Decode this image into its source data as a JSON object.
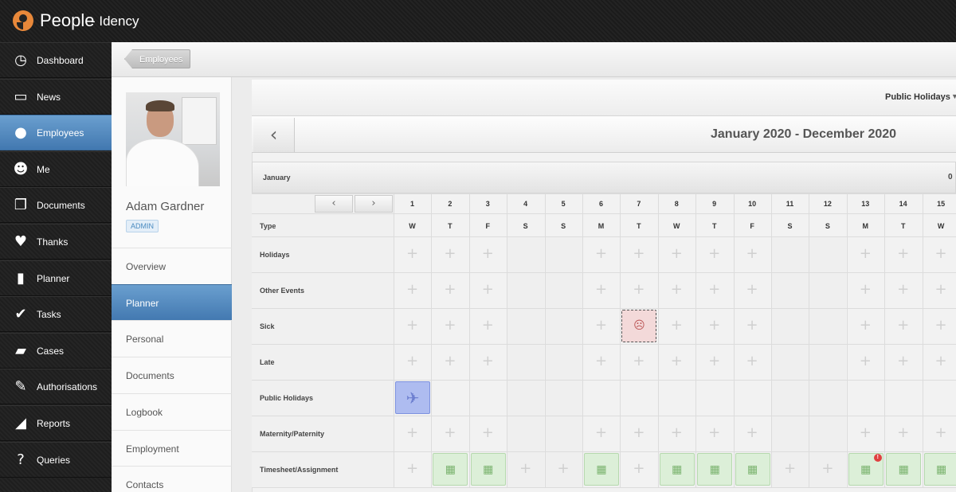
{
  "app": {
    "title": "People",
    "subtitle": "- Idency"
  },
  "sidebar": {
    "items": [
      {
        "label": "Dashboard",
        "icon": "dashboard-icon",
        "glyph": "◷"
      },
      {
        "label": "News",
        "icon": "tv-icon",
        "glyph": "▭"
      },
      {
        "label": "Employees",
        "icon": "people-icon",
        "glyph": "●",
        "active": true
      },
      {
        "label": "Me",
        "icon": "user-star-icon",
        "glyph": "☻"
      },
      {
        "label": "Documents",
        "icon": "documents-icon",
        "glyph": "❐"
      },
      {
        "label": "Thanks",
        "icon": "thumbs-up-icon",
        "glyph": "♥"
      },
      {
        "label": "Planner",
        "icon": "planner-book-icon",
        "glyph": "▮"
      },
      {
        "label": "Tasks",
        "icon": "checkmark-icon",
        "glyph": "✔"
      },
      {
        "label": "Cases",
        "icon": "folder-icon",
        "glyph": "▰"
      },
      {
        "label": "Authorisations",
        "icon": "gavel-icon",
        "glyph": "✎"
      },
      {
        "label": "Reports",
        "icon": "chart-icon",
        "glyph": "◢"
      },
      {
        "label": "Queries",
        "icon": "question-doc-icon",
        "glyph": "?"
      }
    ]
  },
  "breadcrumb": {
    "label": "Employees"
  },
  "profile": {
    "name": "Adam Gardner",
    "role": "ADMIN"
  },
  "subnav": [
    {
      "label": "Overview"
    },
    {
      "label": "Planner",
      "active": true
    },
    {
      "label": "Personal"
    },
    {
      "label": "Documents"
    },
    {
      "label": "Logbook"
    },
    {
      "label": "Employment"
    },
    {
      "label": "Contacts"
    }
  ],
  "planner": {
    "filter": "Public Holidays",
    "range_title": "January 2020 - December 2020",
    "month": "January",
    "month_count": "0",
    "pager_prev": "‹",
    "pager_next": "›",
    "type_header": "Type",
    "days": [
      "1",
      "2",
      "3",
      "4",
      "5",
      "6",
      "7",
      "8",
      "9",
      "10",
      "11",
      "12",
      "13",
      "14",
      "15"
    ],
    "weekdays": [
      "W",
      "T",
      "F",
      "S",
      "S",
      "M",
      "T",
      "W",
      "T",
      "F",
      "S",
      "S",
      "M",
      "T",
      "W"
    ],
    "weekend_days": [
      "4",
      "5",
      "11",
      "12"
    ],
    "rows": [
      {
        "label": "Holidays"
      },
      {
        "label": "Other Events"
      },
      {
        "label": "Sick"
      },
      {
        "label": "Late"
      },
      {
        "label": "Public Holidays"
      },
      {
        "label": "Maternity/Paternity"
      },
      {
        "label": "Timesheet/Assignment"
      }
    ],
    "entries": [
      {
        "row": "Sick",
        "day": "7",
        "kind": "sick",
        "icon": "sad-face-icon"
      },
      {
        "row": "Public Holidays",
        "day": "1",
        "kind": "public-holiday",
        "icon": "airplane-icon"
      },
      {
        "row": "Timesheet/Assignment",
        "day": "2",
        "kind": "timesheet",
        "icon": "calendar-icon"
      },
      {
        "row": "Timesheet/Assignment",
        "day": "3",
        "kind": "timesheet",
        "icon": "calendar-icon"
      },
      {
        "row": "Timesheet/Assignment",
        "day": "6",
        "kind": "timesheet",
        "icon": "calendar-icon"
      },
      {
        "row": "Timesheet/Assignment",
        "day": "8",
        "kind": "timesheet",
        "icon": "calendar-icon"
      },
      {
        "row": "Timesheet/Assignment",
        "day": "9",
        "kind": "timesheet",
        "icon": "calendar-icon"
      },
      {
        "row": "Timesheet/Assignment",
        "day": "10",
        "kind": "timesheet",
        "icon": "calendar-icon"
      },
      {
        "row": "Timesheet/Assignment",
        "day": "13",
        "kind": "timesheet",
        "icon": "calendar-icon",
        "alert": "!"
      },
      {
        "row": "Timesheet/Assignment",
        "day": "14",
        "kind": "timesheet",
        "icon": "calendar-icon"
      },
      {
        "row": "Timesheet/Assignment",
        "day": "15",
        "kind": "timesheet",
        "icon": "calendar-icon"
      }
    ]
  },
  "colors": {
    "accent": "#4a82bb",
    "timesheet": "#dcefd8",
    "sick": "#f3d9d9",
    "public_holiday": "#aebcf0"
  }
}
